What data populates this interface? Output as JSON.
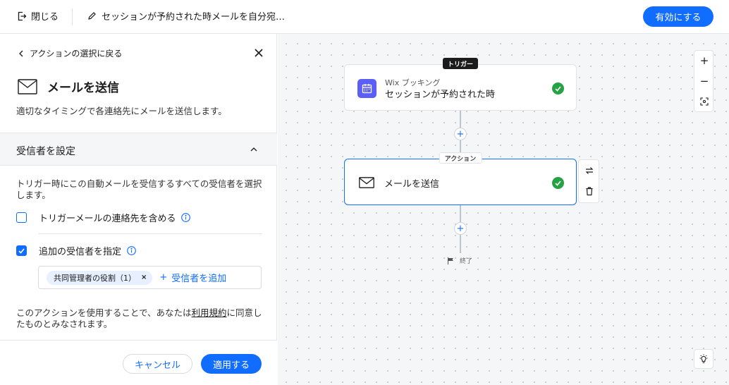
{
  "topbar": {
    "close_label": "閉じる",
    "title": "セッションが予約された時メールを自分宛…",
    "activate_label": "有効にする"
  },
  "panel": {
    "back_label": "アクションの選択に戻る",
    "title": "メールを送信",
    "description": "適切なタイミングで各連絡先にメールを送信します。",
    "section_title": "受信者を設定",
    "section_desc": "トリガー時にこの自動メールを受信するすべての受信者を選択します。",
    "option1_label": "トリガーメールの連絡先を含める",
    "option1_checked": false,
    "option2_label": "追加の受信者を指定",
    "option2_checked": true,
    "recipient_tag": "共同管理者の役割（1）",
    "add_recipient_label": "受信者を追加",
    "terms_before": "このアクションを使用することで、あなたは",
    "terms_link": "利用規約",
    "terms_after": "に同意したものとみなされます。",
    "cancel_label": "キャンセル",
    "apply_label": "適用する"
  },
  "canvas": {
    "trigger_badge": "トリガー",
    "trigger_app": "Wix ブッキング",
    "trigger_event": "セッションが予約された時",
    "action_badge": "アクション",
    "action_label": "メールを送信",
    "end_label": "終了"
  },
  "colors": {
    "accent": "#116dff",
    "success": "#25a244",
    "app_icon": "#5b5ef7"
  }
}
